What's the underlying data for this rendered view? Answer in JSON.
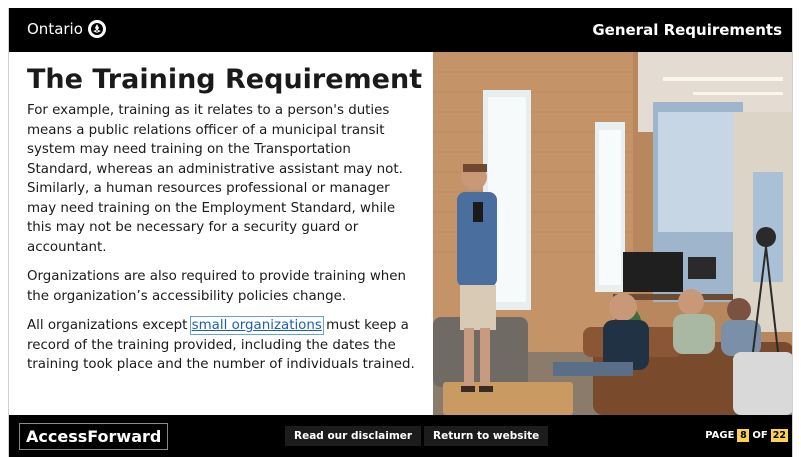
{
  "header": {
    "brand": "Ontario",
    "section_title": "General Requirements"
  },
  "main": {
    "heading": "The Training Requirement",
    "paragraph1": "For example, training as it relates to a person's duties means a public relations officer of a municipal transit system may need training on the Transportation Standard, whereas an administrative assistant may not. Similarly, a human resources professional or manager may need training on the Employment Standard, while this may not be necessary for a security guard or accountant.",
    "paragraph2": "Organizations are also required to provide training when the organization’s accessibility policies change.",
    "paragraph3_before": "All organizations except ",
    "paragraph3_link": "small organizations",
    "paragraph3_after": " must keep a record of the training provided, including the dates the training took place and the number of individuals trained."
  },
  "footer": {
    "logo": "AccessForward",
    "disclaimer_label": "Read our disclaimer",
    "return_label": "Return to website",
    "page_label": "PAGE",
    "current_page": "8",
    "of_label": "OF",
    "total_pages": "22"
  },
  "colors": {
    "header_bg": "#000000",
    "link": "#1a5fb4",
    "page_badge": "#ffd24d"
  }
}
